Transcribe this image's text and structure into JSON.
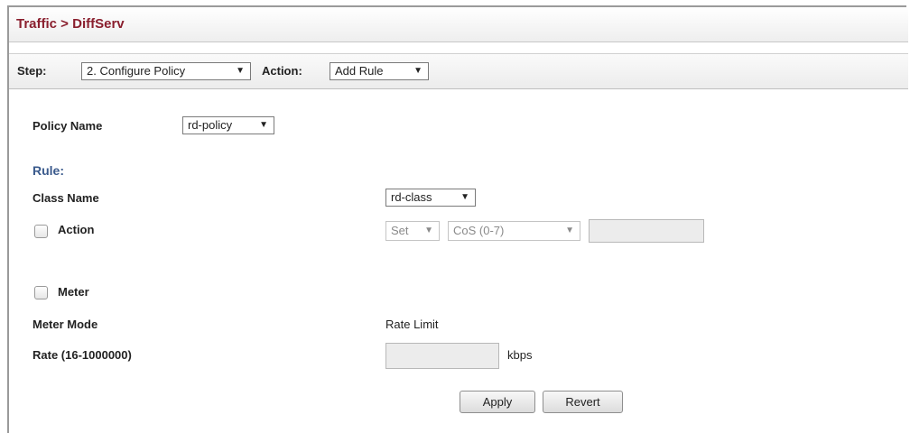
{
  "header": {
    "title": "Traffic > DiffServ"
  },
  "stepbar": {
    "step_label": "Step:",
    "step_value": "2. Configure Policy",
    "action_label": "Action:",
    "action_value": "Add Rule"
  },
  "form": {
    "policy_name_label": "Policy Name",
    "policy_name_value": "rd-policy",
    "rule_header": "Rule:",
    "class_name_label": "Class Name",
    "class_name_value": "rd-class",
    "action_label": "Action",
    "action_set_value": "Set",
    "action_cos_value": "CoS (0-7)",
    "action_value_input": "",
    "meter_label": "Meter",
    "meter_mode_label": "Meter Mode",
    "meter_mode_value": "Rate Limit",
    "rate_label": "Rate (16-1000000)",
    "rate_value": "",
    "rate_unit": "kbps"
  },
  "buttons": {
    "apply": "Apply",
    "revert": "Revert"
  },
  "icons": {
    "dropdown": "▼"
  },
  "colors": {
    "title": "#8a1f2e",
    "rule_header": "#3a5a8c"
  }
}
